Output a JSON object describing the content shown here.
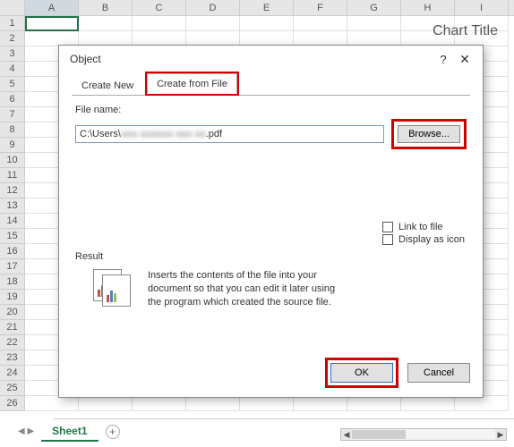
{
  "grid": {
    "columns": [
      "A",
      "B",
      "C",
      "D",
      "E",
      "F",
      "G",
      "H",
      "I"
    ],
    "rows_visible": 26,
    "selected_cell": "A1"
  },
  "chart_overlay": {
    "title": "Chart Title"
  },
  "dialog": {
    "title": "Object",
    "help_tooltip": "?",
    "close_tooltip": "✕",
    "tabs": {
      "create_new": "Create New",
      "create_from_file": "Create from File",
      "active": "create_from_file"
    },
    "file_name_label": "File name:",
    "file_name_value_prefix": "C:\\Users\\",
    "file_name_value_suffix": ".pdf",
    "browse_label": "Browse...",
    "link_to_file_label": "Link to file",
    "display_as_icon_label": "Display as icon",
    "result_label": "Result",
    "result_text": "Inserts the contents of the file into your document so that you can edit it later using the program which created the source file.",
    "ok_label": "OK",
    "cancel_label": "Cancel"
  },
  "sheet_tabs": {
    "active": "Sheet1",
    "add_tooltip": "+"
  }
}
